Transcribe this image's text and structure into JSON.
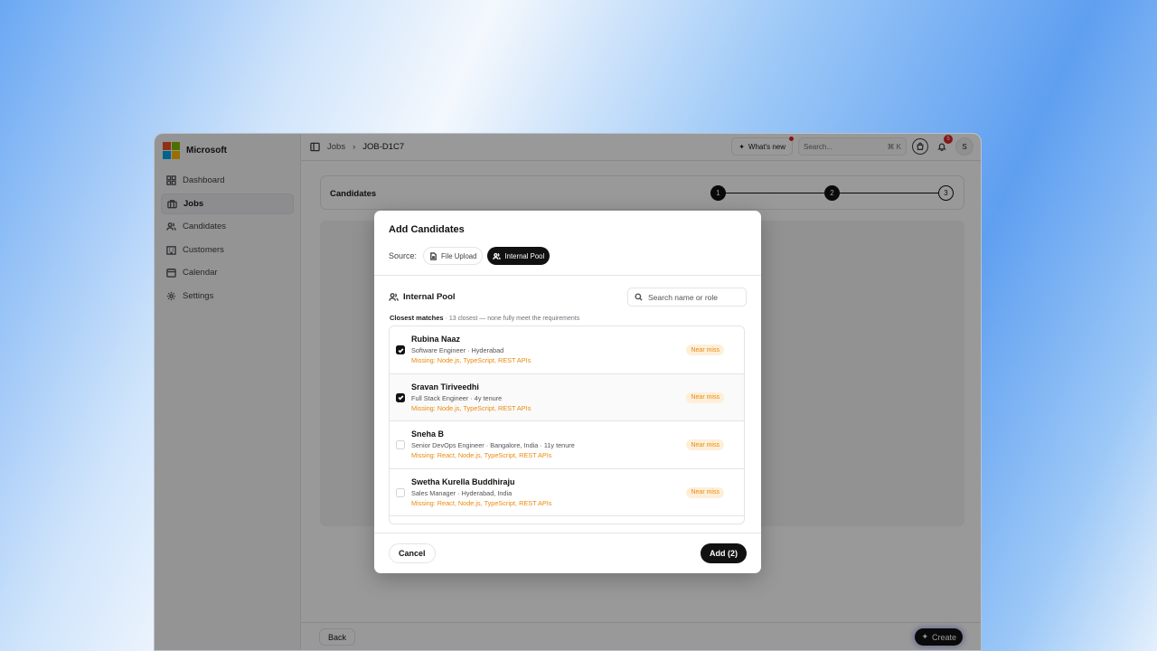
{
  "app": {
    "brand": "Microsoft",
    "logo_colors": [
      "#f25022",
      "#7fba00",
      "#00a4ef",
      "#ffb900"
    ]
  },
  "sidebar": {
    "items": [
      {
        "label": "Dashboard",
        "icon": "dashboard-icon"
      },
      {
        "label": "Jobs",
        "icon": "briefcase-icon",
        "active": true
      },
      {
        "label": "Candidates",
        "icon": "users-icon"
      },
      {
        "label": "Customers",
        "icon": "building-icon"
      },
      {
        "label": "Calendar",
        "icon": "calendar-icon"
      },
      {
        "label": "Settings",
        "icon": "gear-icon"
      }
    ]
  },
  "topbar": {
    "breadcrumb": [
      "Jobs",
      "JOB-D1C7"
    ],
    "whats_new": "What's new",
    "search_placeholder": "Search...",
    "search_shortcut": "⌘ K",
    "notification_count": "5",
    "avatar_initial": "S"
  },
  "stepper": {
    "title": "Candidates",
    "steps": [
      "1",
      "2",
      "3"
    ],
    "current_step": 3
  },
  "footer": {
    "back_label": "Back",
    "create_label": "Create"
  },
  "modal": {
    "title": "Add Candidates",
    "source_label": "Source:",
    "sources": [
      {
        "label": "File Upload",
        "selected": false
      },
      {
        "label": "Internal Pool",
        "selected": true
      }
    ],
    "pool_heading": "Internal Pool",
    "search_placeholder": "Search name or role",
    "matches_title": "Closest matches",
    "matches_note": "· 13 closest — none fully meet the requirements",
    "candidates": [
      {
        "name": "Rubina Naaz",
        "subtitle": "Software Engineer · Hyderabad",
        "missing": "Missing: Node.js, TypeScript, REST APIs",
        "tag": "Near miss",
        "checked": true
      },
      {
        "name": "Sravan Tiriveedhi",
        "subtitle": "Full Stack Engineer · 4y tenure",
        "missing": "Missing: Node.js, TypeScript, REST APIs",
        "tag": "Near miss",
        "checked": true
      },
      {
        "name": "Sneha B",
        "subtitle": "Senior DevOps Engineer · Bangalore, India · 11y tenure",
        "missing": "Missing: React, Node.js, TypeScript, REST APIs",
        "tag": "Near miss",
        "checked": false
      },
      {
        "name": "Swetha Kurella Buddhiraju",
        "subtitle": "Sales Manager · Hyderabad, India",
        "missing": "Missing: React, Node.js, TypeScript, REST APIs",
        "tag": "Near miss",
        "checked": false
      }
    ],
    "cancel_label": "Cancel",
    "add_label": "Add (2)"
  },
  "colors": {
    "accent": "#111111",
    "warning": "#ea8a0c",
    "warning_bg": "#fdefd9",
    "danger": "#dc2626"
  }
}
